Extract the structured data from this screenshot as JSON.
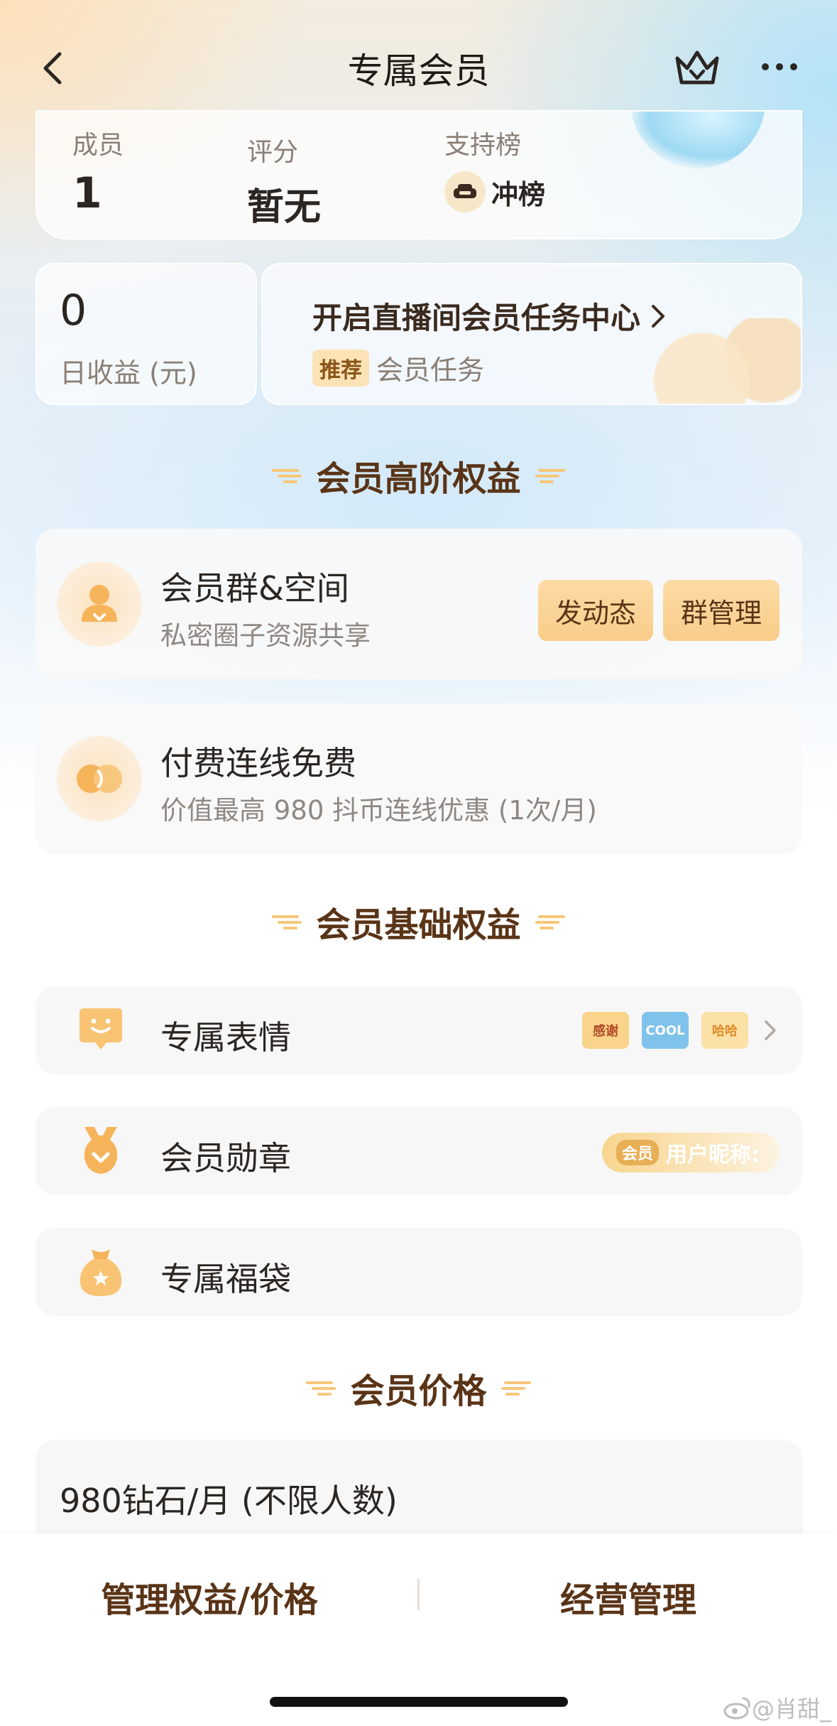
{
  "nav": {
    "title": "专属会员"
  },
  "stats": {
    "members_label": "成员",
    "members_value": "1",
    "rating_label": "评分",
    "rating_value": "暂无",
    "support_label": "支持榜",
    "support_action": "冲榜"
  },
  "earnings": {
    "value": "0",
    "label": "日收益 (元)"
  },
  "task_center": {
    "title": "开启直播间会员任务中心",
    "tag": "推荐",
    "subtitle": "会员任务"
  },
  "sections": {
    "advanced": "会员高阶权益",
    "basic": "会员基础权益",
    "price": "会员价格"
  },
  "advanced_benefits": [
    {
      "title": "会员群&空间",
      "desc": "私密圈子资源共享",
      "buttons": [
        "发动态",
        "群管理"
      ]
    },
    {
      "title": "付费连线免费",
      "desc": "价值最高 980 抖币连线优惠 (1次/月)"
    }
  ],
  "basic_benefits": [
    {
      "title": "专属表情",
      "stickers": [
        "感谢",
        "COOL",
        "哈哈"
      ]
    },
    {
      "title": "会员勋章",
      "badge_tag": "会员",
      "badge_name": "用户昵称:"
    },
    {
      "title": "专属福袋"
    }
  ],
  "price": {
    "text": "980钻石/月 (不限人数)"
  },
  "bottom_bar": {
    "left": "管理权益/价格",
    "right": "经营管理"
  },
  "watermark": "@肖甜_",
  "colors": {
    "accent": "#5a3417",
    "button": "#f9cd8a",
    "tag_bg": "#fbe3b6"
  }
}
